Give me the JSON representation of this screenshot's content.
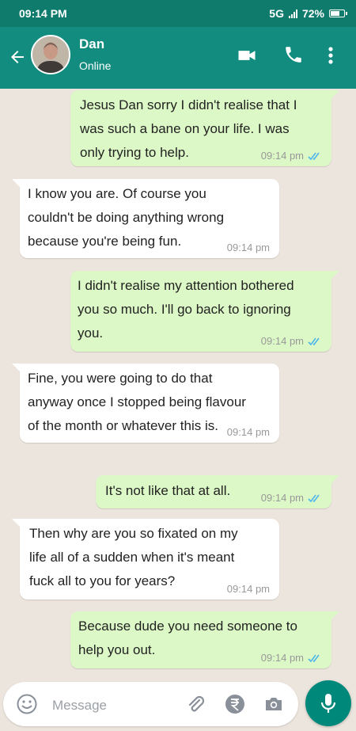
{
  "status_bar": {
    "time": "09:14 PM",
    "network": "5G",
    "battery_percent": "72%",
    "battery_level": 0.72
  },
  "header": {
    "contact_name": "Dan",
    "contact_status": "Online",
    "icons": [
      "back-arrow-icon",
      "video-call-icon",
      "phone-icon",
      "more-options-icon"
    ]
  },
  "messages": [
    {
      "direction": "outgoing",
      "lines": [
        "Jesus Dan sorry I didn't realise that I",
        "was such a bane on your life. I was",
        "only trying to help."
      ],
      "time": "09:14 pm",
      "ticks": "read"
    },
    {
      "direction": "incoming",
      "lines": [
        "I know you are. Of course you",
        "couldn't be doing anything wrong",
        "because you're being fun."
      ],
      "time": "09:14 pm"
    },
    {
      "direction": "outgoing",
      "lines": [
        "I didn't realise my attention bothered",
        "you so much. I'll go back to ignoring",
        "you."
      ],
      "time": "09:14 pm",
      "ticks": "read"
    },
    {
      "direction": "incoming",
      "lines": [
        "Fine, you were going to do that",
        "anyway once I stopped being flavour",
        "of the month or whatever this is."
      ],
      "time": "09:14 pm"
    },
    {
      "direction": "outgoing",
      "lines": [
        "It's not like that at all."
      ],
      "time": "09:14 pm",
      "ticks": "read"
    },
    {
      "direction": "incoming",
      "lines": [
        "Then why are you so fixated on my",
        "life all of a sudden when it's meant",
        "fuck all to you for years?"
      ],
      "time": "09:14 pm"
    },
    {
      "direction": "outgoing",
      "lines": [
        "Because dude you need someone to",
        "help you out."
      ],
      "time": "09:14 pm",
      "ticks": "read"
    }
  ],
  "composer": {
    "placeholder": "Message",
    "icons": [
      "emoji-icon",
      "attachment-icon",
      "rupee-payment-icon",
      "camera-icon",
      "microphone-icon"
    ]
  },
  "colors": {
    "status_bar": "#0e7b6d",
    "app_bar": "#128c7e",
    "outgoing_bubble": "#dcf8c6",
    "incoming_bubble": "#ffffff",
    "read_ticks": "#4fb6ec",
    "mic_button": "#00897b",
    "chat_background": "#ece5dd"
  }
}
